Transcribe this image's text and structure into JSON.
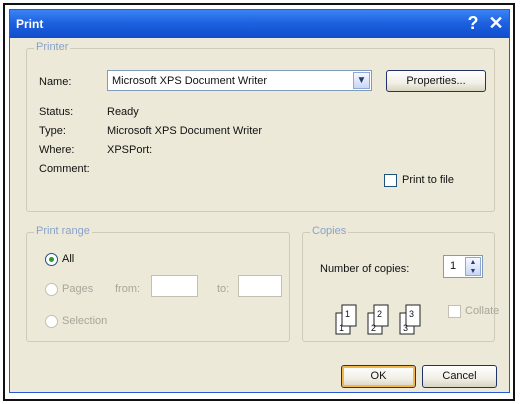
{
  "window": {
    "title": "Print",
    "help_glyph": "?",
    "close_glyph": "✕"
  },
  "printer": {
    "legend": "Printer",
    "name_label": "Name:",
    "name_value": "Microsoft XPS Document Writer",
    "properties_label": "Properties...",
    "status_label": "Status:",
    "status_value": "Ready",
    "type_label": "Type:",
    "type_value": "Microsoft XPS Document Writer",
    "where_label": "Where:",
    "where_value": "XPSPort:",
    "comment_label": "Comment:",
    "print_to_file_label": "Print to file"
  },
  "print_range": {
    "legend": "Print range",
    "all_label": "All",
    "pages_label": "Pages",
    "from_label": "from:",
    "to_label": "to:",
    "selection_label": "Selection",
    "selected": "All"
  },
  "copies": {
    "legend": "Copies",
    "number_label": "Number of copies:",
    "number_value": "1",
    "collate_label": "Collate",
    "collate_pages": [
      "1",
      "1",
      "2",
      "2",
      "3",
      "3"
    ]
  },
  "footer": {
    "ok_label": "OK",
    "cancel_label": "Cancel"
  },
  "colors": {
    "titlebar": "#0f4ccc",
    "dialog_bg": "#ece9d8",
    "legend_text": "#8aa2c8",
    "default_button_ring": "#f2b748"
  }
}
